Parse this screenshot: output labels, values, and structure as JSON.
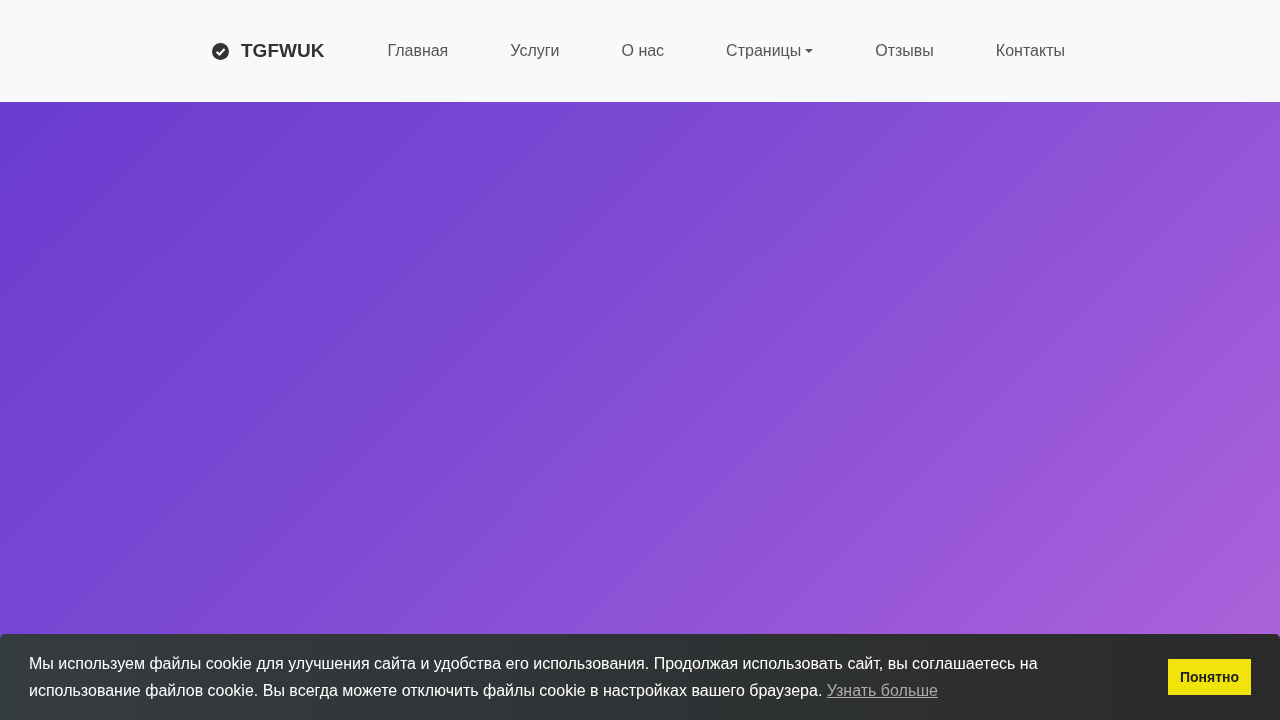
{
  "navbar": {
    "brand": "TGFWUK",
    "items": [
      {
        "label": "Главная",
        "dropdown": false
      },
      {
        "label": "Услуги",
        "dropdown": false
      },
      {
        "label": "О нас",
        "dropdown": false
      },
      {
        "label": "Страницы",
        "dropdown": true
      },
      {
        "label": "Отзывы",
        "dropdown": false
      },
      {
        "label": "Контакты",
        "dropdown": false
      }
    ]
  },
  "cookie_banner": {
    "text": "Мы используем файлы cookie для улучшения сайта и удобства его использования. Продолжая использовать сайт, вы соглашаетесь на использование файлов cookie. Вы всегда можете отключить файлы cookie в настройках вашего браузера.",
    "link": "Узнать больше",
    "button": "Понятно"
  }
}
